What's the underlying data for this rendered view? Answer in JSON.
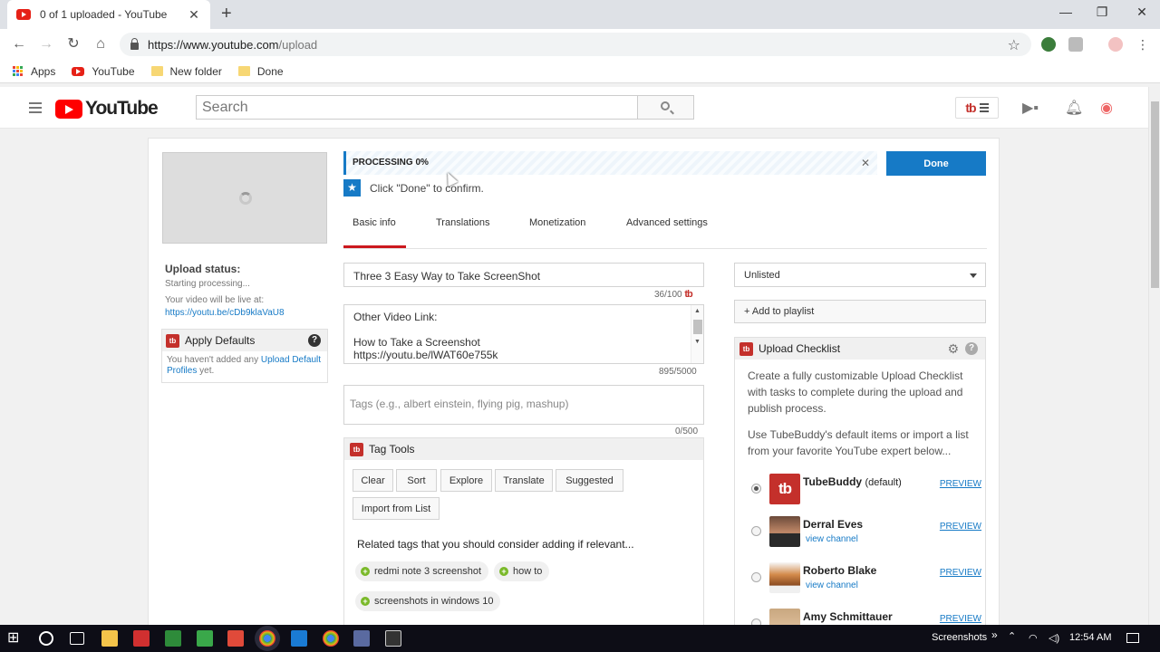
{
  "browser": {
    "tab_title": "0 of 1 uploaded - YouTube",
    "url_host": "https://www.youtube.com",
    "url_path": "/upload",
    "bookmarks": [
      "Apps",
      "YouTube",
      "New folder",
      "Done"
    ]
  },
  "masthead": {
    "logo_text": "YouTube",
    "search_placeholder": "Search"
  },
  "upload": {
    "status_label": "Upload status:",
    "status_text": "Starting processing...",
    "live_text": "Your video will be live at:",
    "live_url": "https://youtu.be/cDb9klaVaU8",
    "apply_defaults": {
      "title": "Apply Defaults",
      "body_prefix": "You haven't added any ",
      "link": "Upload Default Profiles",
      "body_suffix": " yet."
    },
    "progress": {
      "label": "PROCESSING 0%",
      "percent": 0
    },
    "done_label": "Done",
    "confirm_text": "Click \"Done\" to confirm.",
    "tabs": [
      "Basic info",
      "Translations",
      "Monetization",
      "Advanced settings"
    ],
    "title_value": "Three 3  Easy Way to Take ScreenShot",
    "title_counter": "36/100",
    "description_lines": [
      "Other Video Link:",
      "",
      "How to Take a Screenshot",
      "https://youtu.be/lWAT60e755k"
    ],
    "description_counter": "895/5000",
    "tags_placeholder": "Tags (e.g., albert einstein, flying pig, mashup)",
    "tags_counter": "0/500",
    "privacy": "Unlisted",
    "add_playlist": "+ Add to playlist"
  },
  "tag_tools": {
    "title": "Tag Tools",
    "buttons": [
      "Clear",
      "Sort",
      "Explore",
      "Translate",
      "Suggested",
      "Import from List"
    ],
    "related_heading": "Related tags that you should consider adding if relevant...",
    "related_tags": [
      "redmi note 3 screenshot",
      "how to",
      "screenshots in windows 10"
    ]
  },
  "checklist": {
    "title": "Upload Checklist",
    "intro1": "Create a fully customizable Upload Checklist with tasks to complete during the upload and publish process.",
    "intro2": "Use TubeBuddy's default items or import a list from your favorite YouTube expert below...",
    "profiles": [
      {
        "name": "TubeBuddy",
        "tag": "(default)",
        "channel": "",
        "preview": "PREVIEW",
        "selected": true
      },
      {
        "name": "Derral Eves",
        "tag": "",
        "channel": "view channel",
        "preview": "PREVIEW",
        "selected": false
      },
      {
        "name": "Roberto Blake",
        "tag": "",
        "channel": "view channel",
        "preview": "PREVIEW",
        "selected": false
      },
      {
        "name": "Amy Schmittauer",
        "tag": "",
        "channel": "",
        "preview": "PREVIEW",
        "selected": false
      }
    ]
  },
  "taskbar": {
    "screenshots_label": "Screenshots",
    "time": "12:54 AM"
  },
  "colors": {
    "youtube_red": "#ff0000",
    "accent_blue": "#167ac6",
    "tubebuddy_red": "#c4302b"
  }
}
